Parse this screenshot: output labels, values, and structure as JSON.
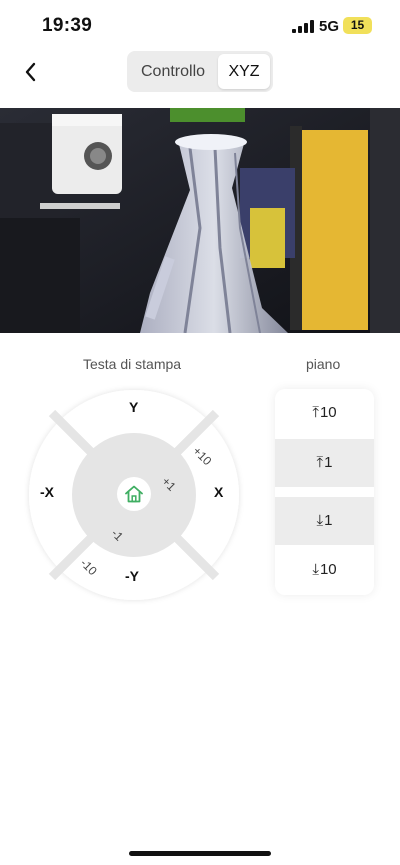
{
  "status_bar": {
    "time": "19:39",
    "network": "5G",
    "battery": "15"
  },
  "header": {
    "tabs": [
      {
        "label": "Controllo",
        "active": false
      },
      {
        "label": "XYZ",
        "active": true
      }
    ]
  },
  "camera": {
    "description": ""
  },
  "print_head": {
    "title": "Testa di stampa",
    "labels": {
      "y_plus": "Y",
      "y_minus": "-Y",
      "x_plus": "X",
      "x_minus": "-X"
    },
    "steps": {
      "plus_10": "+10",
      "plus_1": "+1",
      "minus_1": "-1",
      "minus_10": "-10"
    }
  },
  "bed": {
    "title": "piano",
    "buttons": [
      {
        "arrow": "up",
        "value": "10"
      },
      {
        "arrow": "up",
        "value": "1"
      },
      {
        "arrow": "down",
        "value": "1"
      },
      {
        "arrow": "down",
        "value": "10"
      }
    ]
  },
  "colors": {
    "accent": "#3fae62",
    "pad_outer": "#ffffff",
    "pad_inner": "#e5e5e5",
    "shade": "#ececec"
  }
}
